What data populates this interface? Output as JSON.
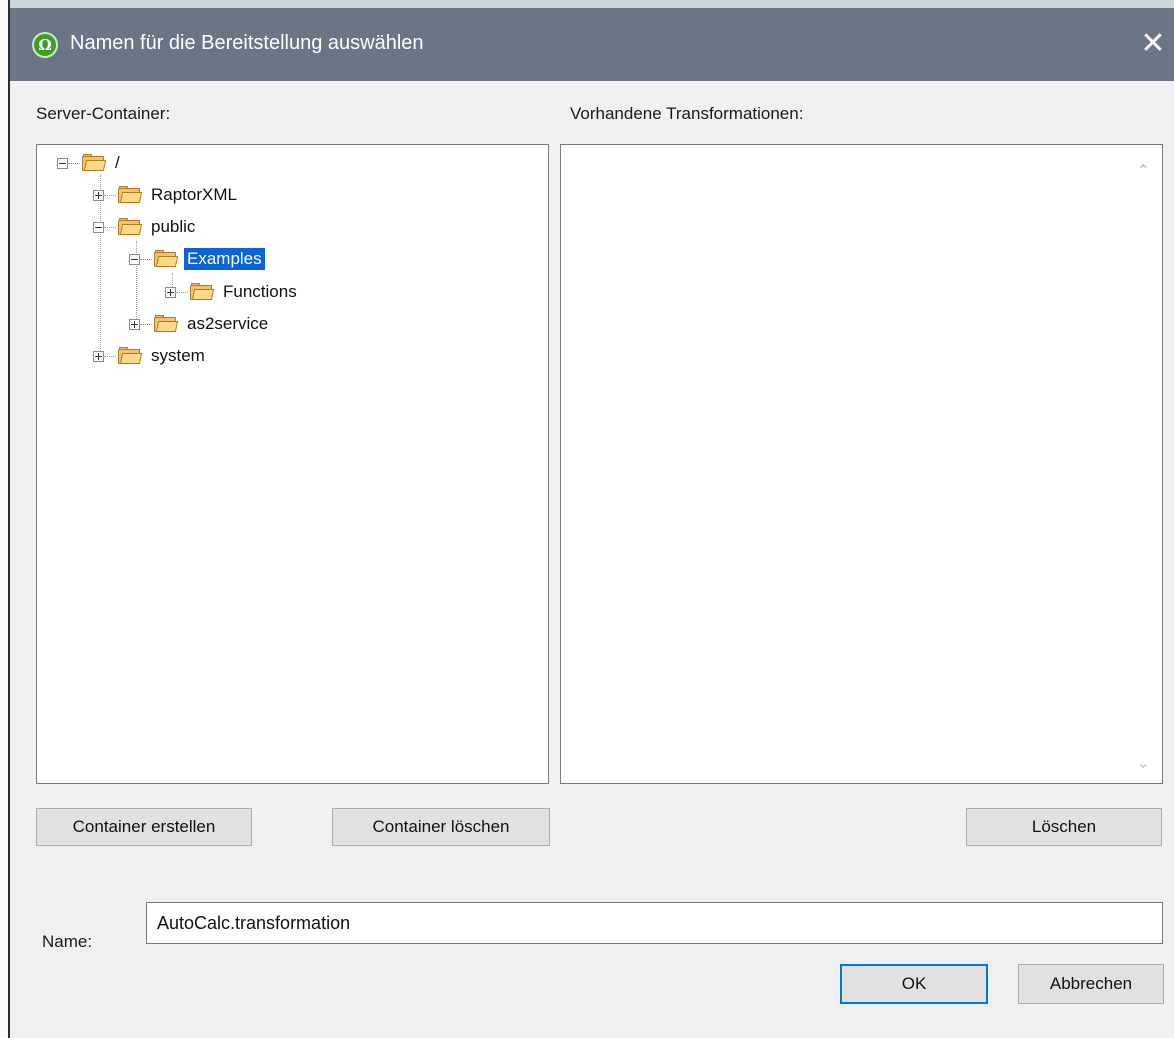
{
  "window": {
    "title": "Namen für die Bereitstellung auswählen",
    "app_icon": "altova-app-icon",
    "close_glyph": "✕"
  },
  "labels": {
    "server_container": "Server-Container:",
    "existing_transformations": "Vorhandene Transformationen:",
    "name": "Name:"
  },
  "tree": {
    "nodes": [
      {
        "label": "/",
        "expanded": true,
        "selected": false,
        "depth": 0
      },
      {
        "label": "RaptorXML",
        "expanded": false,
        "selected": false,
        "depth": 1
      },
      {
        "label": "public",
        "expanded": true,
        "selected": false,
        "depth": 1
      },
      {
        "label": "Examples",
        "expanded": true,
        "selected": true,
        "depth": 2
      },
      {
        "label": "Functions",
        "expanded": false,
        "selected": false,
        "depth": 3
      },
      {
        "label": "as2service",
        "expanded": false,
        "selected": false,
        "depth": 2
      },
      {
        "label": "system",
        "expanded": false,
        "selected": false,
        "depth": 1
      }
    ]
  },
  "transformations": {
    "items": [],
    "scroll_up_glyph": "⌃",
    "scroll_down_glyph": "⌄"
  },
  "buttons": {
    "create_container": "Container erstellen",
    "delete_container": "Container löschen",
    "delete": "Löschen",
    "ok": "OK",
    "cancel": "Abbrechen"
  },
  "name_field": {
    "value": "AutoCalc.transformation"
  },
  "colors": {
    "titlebar": "#6a7585",
    "selection": "#0a64d6",
    "folder": "#f3c26a",
    "default_button_border": "#0078d7"
  }
}
